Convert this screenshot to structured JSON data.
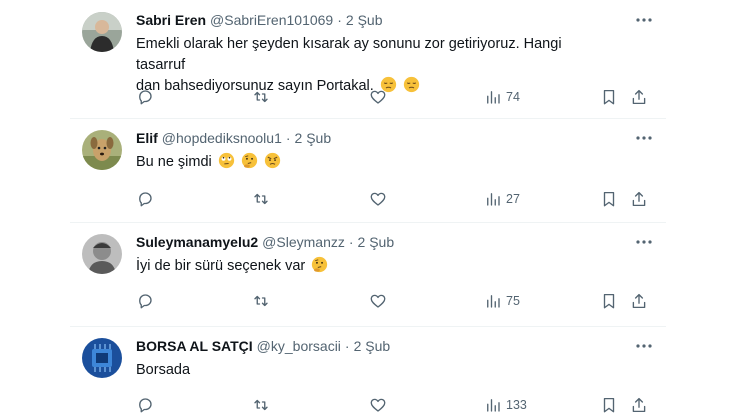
{
  "tweets": [
    {
      "name": "Sabri Eren",
      "handle": "@SabriEren101069",
      "separator": "·",
      "date": "2 Şub",
      "text_lines": [
        "Emekli olarak her şeyden kısarak ay sonunu zor getiriyoruz. Hangi tasarruf",
        "dan bahsediyorsunuz sayın Portakal."
      ],
      "emojis": [
        "pensive-face",
        "pensive-face"
      ],
      "views": "74"
    },
    {
      "name": "Elif",
      "handle": "@hopdediksnoolu1",
      "separator": "·",
      "date": "2 Şub",
      "text_lines": [
        "Bu ne şimdi"
      ],
      "emojis": [
        "face-with-rolling-eyes",
        "thinking-face",
        "angry-face"
      ],
      "views": "27"
    },
    {
      "name": "Suleymanamyelu2",
      "handle": "@Sleymanzz",
      "separator": "·",
      "date": "2 Şub",
      "text_lines": [
        "İyi de bir sürü seçenek var"
      ],
      "emojis": [
        "thinking-face"
      ],
      "views": "75"
    },
    {
      "name": "BORSA AL SATÇI",
      "handle": "@ky_borsacii",
      "separator": "·",
      "date": "2 Şub",
      "text_lines": [
        "Borsada"
      ],
      "emojis": [],
      "views": "133"
    }
  ],
  "icons": {
    "reply": "reply-icon",
    "retweet": "retweet-icon",
    "like": "heart-icon",
    "views": "views-chart-icon",
    "bookmark": "bookmark-icon",
    "share": "share-icon",
    "more": "more-dots-icon"
  },
  "colors": {
    "text": "#0f1419",
    "secondary": "#536471",
    "divider": "#eff3f4",
    "emoji_yellow": "#f7c13a"
  }
}
